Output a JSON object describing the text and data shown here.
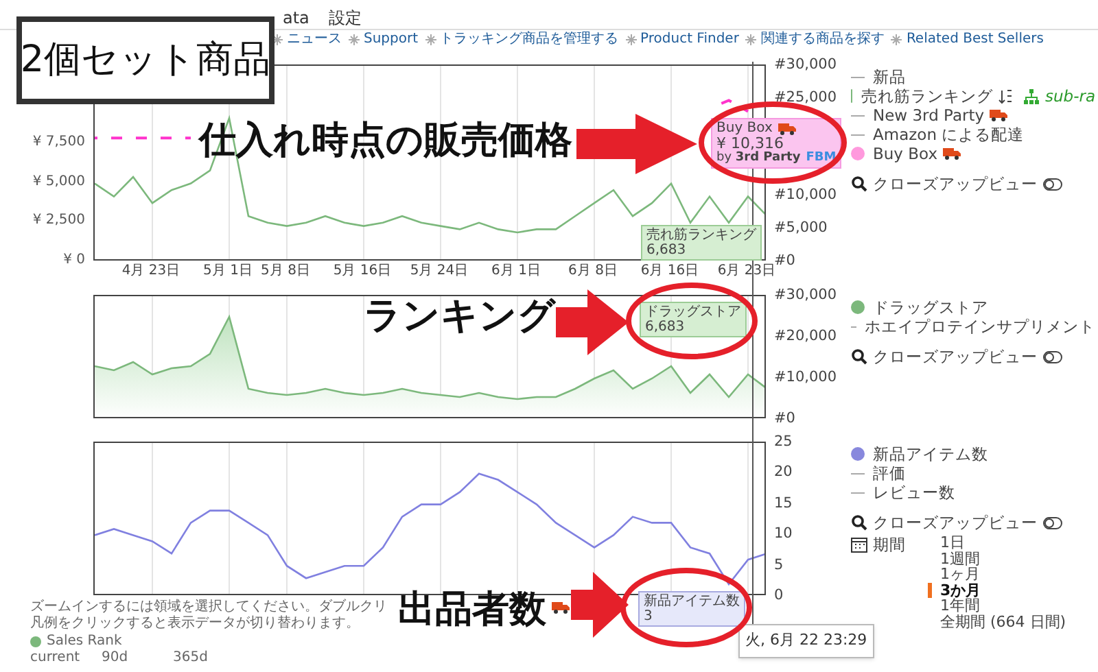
{
  "nav": {
    "items": [
      "ata",
      "設定"
    ]
  },
  "links": [
    "ニュース",
    "Support",
    "トラッキング商品を管理する",
    "Product Finder",
    "関連する商品を探す",
    "Related Best Sellers"
  ],
  "charts": [
    {
      "chart_data": {
        "type": "line",
        "grid": true,
        "ylim": [
          0,
          30000
        ],
        "y2lim": [
          0,
          12500
        ],
        "categories": [
          null,
          null,
          null,
          "4月 23日",
          null,
          null,
          null,
          "5月 1日",
          null,
          null,
          "5月 8日",
          null,
          null,
          null,
          "5月 16日",
          null,
          null,
          null,
          "5月 24日",
          null,
          null,
          null,
          "6月 1日",
          null,
          null,
          null,
          "6月 8日",
          null,
          null,
          null,
          "6月 16日",
          null,
          null,
          null,
          "6月 23日",
          null
        ],
        "yticks": [
          {
            "value": 0,
            "label": "#0"
          },
          {
            "value": 5000,
            "label": "#5,000"
          },
          {
            "value": 10000,
            "label": "#10,000"
          },
          {
            "value": 25000,
            "label": "#25,000"
          },
          {
            "value": 30000,
            "label": "#30,000"
          }
        ],
        "y2ticks": [
          {
            "value": 0,
            "label": "¥ 0"
          },
          {
            "value": 2500,
            "label": "¥ 2,500"
          },
          {
            "value": 5000,
            "label": "¥ 5,000"
          },
          {
            "value": 7500,
            "label": "¥ 7,500"
          }
        ],
        "series": [
          {
            "name": "売れ筋ランキング",
            "color": "#7cb87c",
            "values": [
              12000,
              10000,
              13000,
              9000,
              11000,
              12000,
              14000,
              22000,
              7000,
              6000,
              5500,
              6000,
              7000,
              6000,
              5500,
              6000,
              7000,
              6000,
              5500,
              5000,
              6000,
              5000,
              4500,
              5000,
              5000,
              7000,
              9000,
              11000,
              7000,
              9000,
              12000,
              6000,
              10000,
              6000,
              10000,
              7000
            ]
          },
          {
            "name": "Buy Box",
            "color": "#ff33cc",
            "axis": "y2",
            "line_style": "dashed",
            "values": [
              7900,
              7900,
              7900,
              7900,
              7900,
              7900,
              null,
              null,
              null,
              null,
              null,
              null,
              null,
              null,
              null,
              null,
              null,
              null,
              null,
              null,
              null,
              null,
              null,
              null,
              null,
              null,
              null,
              null,
              null,
              null,
              null,
              null,
              9800,
              10300,
              9600,
              null
            ]
          }
        ]
      },
      "legend": [
        {
          "kind": "line",
          "label": "新品"
        },
        {
          "kind": "series_dot",
          "color": "#7cb87c",
          "extra": "sub-ra"
        },
        {
          "kind": "line",
          "label": "New 3rd Party",
          "truck": true
        },
        {
          "kind": "line",
          "label": "Amazon による配達"
        },
        {
          "kind": "series_dot",
          "color": "#ff99dd",
          "truck": true
        },
        {
          "kind": "closeup",
          "label": "クローズアップビュー"
        }
      ],
      "tooltips": [
        {
          "kind": "buybox",
          "title": "Buy Box",
          "value": "¥ 10,316",
          "by": "by **3rd Party**",
          "badge": "FBM"
        },
        {
          "kind": "rank",
          "title": "売れ筋ランキング",
          "value": "6,683"
        }
      ]
    },
    {
      "chart_data": {
        "type": "area",
        "grid": true,
        "ylim": [
          0,
          30000
        ],
        "yticks": [
          {
            "value": 0,
            "label": "#0"
          },
          {
            "value": 10000,
            "label": "#10,000"
          },
          {
            "value": 20000,
            "label": "#20,000"
          },
          {
            "value": 30000,
            "label": "#30,000"
          }
        ],
        "series": [
          {
            "name": "ドラッグストア",
            "color": "#7cb87c",
            "values": [
              13000,
              12000,
              14000,
              11000,
              12500,
              13000,
              16000,
              25000,
              7500,
              6500,
              6000,
              6500,
              7500,
              6500,
              6000,
              6500,
              7500,
              6500,
              6000,
              5500,
              6500,
              5500,
              5000,
              5500,
              5500,
              7500,
              10000,
              12000,
              7500,
              10000,
              13000,
              6500,
              11000,
              5500,
              11000,
              7500
            ]
          }
        ]
      },
      "legend": [
        {
          "kind": "series_dot",
          "color": "#7cb87c"
        },
        {
          "kind": "line",
          "label": "ホエイプロテインサプリメント"
        },
        {
          "kind": "closeup",
          "label": "クローズアップビュー"
        }
      ],
      "tooltips": [
        {
          "kind": "rank",
          "title": "ドラッグストア",
          "value": "6,683"
        }
      ]
    },
    {
      "chart_data": {
        "type": "line",
        "grid": true,
        "ylim": [
          0,
          25
        ],
        "yticks": [
          {
            "value": 0,
            "label": "0"
          },
          {
            "value": 5,
            "label": "5"
          },
          {
            "value": 10,
            "label": "10"
          },
          {
            "value": 15,
            "label": "15"
          },
          {
            "value": 20,
            "label": "20"
          },
          {
            "value": 25,
            "label": "25"
          }
        ],
        "series": [
          {
            "name": "新品アイテム数",
            "color": "#8080e0",
            "values": [
              10,
              11,
              10,
              9,
              7,
              12,
              14,
              14,
              12,
              10,
              5,
              3,
              4,
              5,
              5,
              8,
              13,
              15,
              15,
              17,
              20,
              19,
              17,
              15,
              12,
              10,
              8,
              10,
              13,
              12,
              12,
              8,
              7,
              2,
              6,
              7
            ]
          }
        ]
      },
      "legend": [
        {
          "kind": "series_dot",
          "color": "#8888dd"
        },
        {
          "kind": "line",
          "label": "評価"
        },
        {
          "kind": "line",
          "label": "レビュー数"
        },
        {
          "kind": "closeup",
          "label": "クローズアップビュー"
        }
      ],
      "period": {
        "label": "期間",
        "options": [
          {
            "label": "1日",
            "selected": false
          },
          {
            "label": "1週間",
            "selected": false
          },
          {
            "label": "1ヶ月",
            "selected": false
          },
          {
            "label": "3か月",
            "selected": true
          },
          {
            "label": "1年間",
            "selected": false
          },
          {
            "label": "全期間 (664 日間)",
            "selected": false
          }
        ]
      },
      "tooltips": [
        {
          "kind": "count",
          "title": "新品アイテム数",
          "value": "3"
        }
      ]
    }
  ],
  "footer": {
    "hint": [
      "ズームインするには領域を選択してください。ダブルクリ",
      "凡例をクリックすると表示データが切り替わります。"
    ],
    "sales_rank": {
      "label": "Sales Rank",
      "color": "#7cb87c"
    },
    "columns": [
      "current",
      "90d",
      "365d"
    ]
  },
  "crosshair_time": "火, 6月 22 23:29",
  "annotations": [
    {
      "kind": "box",
      "text": "2個セット商品"
    },
    {
      "kind": "arrow",
      "text": "仕入れ時点の販売価格"
    },
    {
      "kind": "arrow",
      "text": "ランキング"
    },
    {
      "kind": "arrow",
      "text": "出品者数"
    }
  ]
}
